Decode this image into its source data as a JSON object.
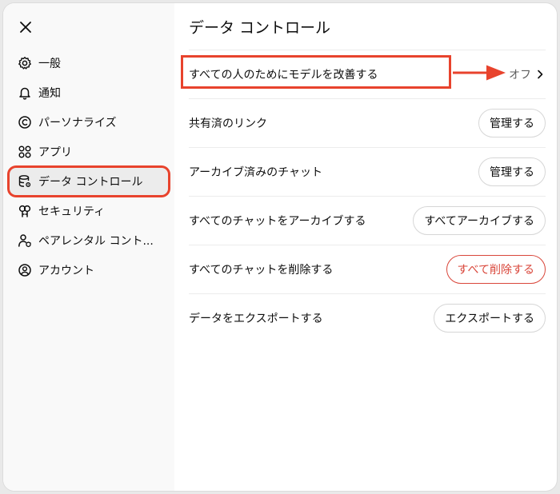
{
  "dialog": {
    "title": "データ コントロール"
  },
  "sidebar": {
    "items": [
      {
        "label": "一般",
        "icon": "gear-icon"
      },
      {
        "label": "通知",
        "icon": "bell-icon"
      },
      {
        "label": "パーソナライズ",
        "icon": "personalize-icon"
      },
      {
        "label": "アプリ",
        "icon": "apps-grid-icon"
      },
      {
        "label": "データ コントロール",
        "icon": "database-icon"
      },
      {
        "label": "セキュリティ",
        "icon": "shield-key-icon"
      },
      {
        "label": "ペアレンタル コント...",
        "icon": "parental-control-icon"
      },
      {
        "label": "アカウント",
        "icon": "user-circle-icon"
      }
    ],
    "active_index": 4
  },
  "settings": {
    "improve_model": {
      "label": "すべての人のためにモデルを改善する",
      "value": "オフ"
    },
    "shared_links": {
      "label": "共有済のリンク",
      "button": "管理する"
    },
    "archived_chats": {
      "label": "アーカイブ済みのチャット",
      "button": "管理する"
    },
    "archive_all": {
      "label": "すべてのチャットをアーカイブする",
      "button": "すべてアーカイブする"
    },
    "delete_all": {
      "label": "すべてのチャットを削除する",
      "button": "すべて削除する"
    },
    "export": {
      "label": "データをエクスポートする",
      "button": "エクスポートする"
    }
  },
  "colors": {
    "annotation": "#e8432d",
    "danger": "#d9463a",
    "active_item_bg": "#ececec",
    "sidebar_bg": "#f9f9f9"
  }
}
